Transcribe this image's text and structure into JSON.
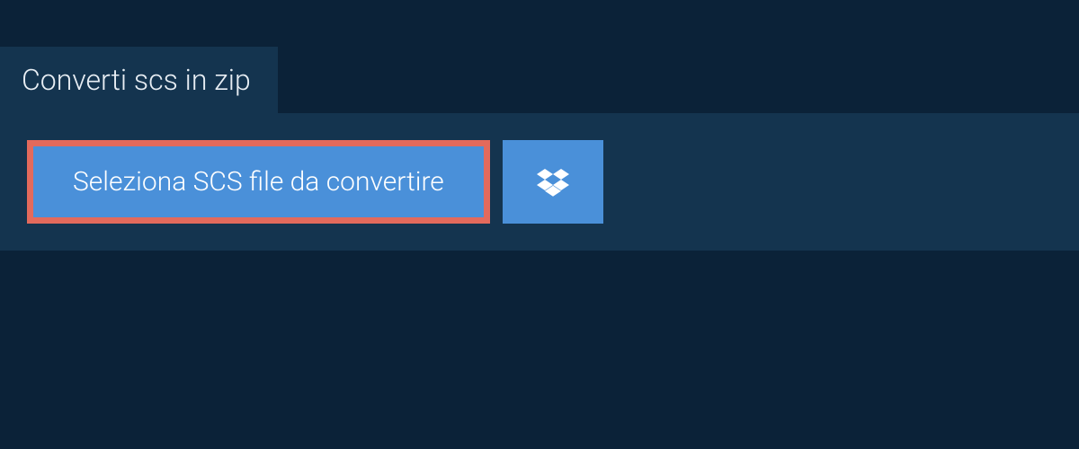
{
  "tab": {
    "title": "Converti scs in zip"
  },
  "actions": {
    "select_file_label": "Seleziona SCS file da convertire",
    "cloud_provider_icon": "dropbox"
  },
  "colors": {
    "background_dark": "#0b2238",
    "panel": "#14344f",
    "button_primary": "#4a90d9",
    "highlight_border": "#e36a5c",
    "text_light": "#e8eef4"
  }
}
